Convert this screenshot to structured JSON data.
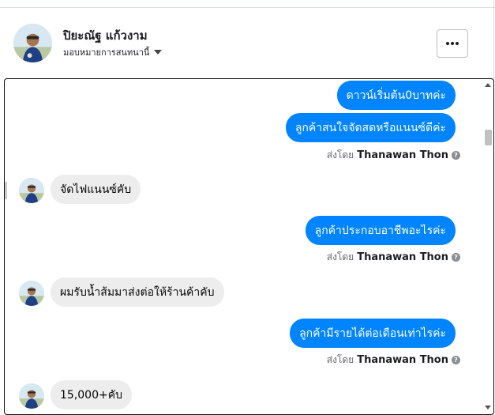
{
  "header": {
    "name": "ปิยะณัฐ แก้วงาม",
    "subtitle": "มอบหมายการสนทนานี้",
    "avatar_icon": "profile-avatar",
    "more_icon": "more-dots-icon"
  },
  "messages": [
    {
      "side": "out",
      "text": "ดาวน์เริ่มต้น0บาทค่ะ"
    },
    {
      "side": "out",
      "text": "ลูกค้าสนใจจัดสดหรือแนนซ์ดีค่ะ"
    },
    {
      "side": "meta",
      "prefix": "ส่งโดย",
      "sender": "Thanawan Thon"
    },
    {
      "side": "in",
      "text": "จัดไฟแนนซ์คับ"
    },
    {
      "side": "out",
      "text": "ลูกค้าประกอบอาชีพอะไรค่ะ"
    },
    {
      "side": "meta",
      "prefix": "ส่งโดย",
      "sender": "Thanawan Thon"
    },
    {
      "side": "in",
      "text": "ผมรับน้ำส้มมาส่งต่อให้ร้านค้าคับ"
    },
    {
      "side": "out",
      "text": "ลูกค้ามีรายได้ต่อเดือนเท่าไรค่ะ"
    },
    {
      "side": "meta",
      "prefix": "ส่งโดย",
      "sender": "Thanawan Thon"
    },
    {
      "side": "in",
      "text": "15,000+คับ"
    }
  ],
  "colors": {
    "outgoing_bubble": "#0084ff",
    "incoming_bubble": "#ededed",
    "meta_text": "#65676b"
  }
}
